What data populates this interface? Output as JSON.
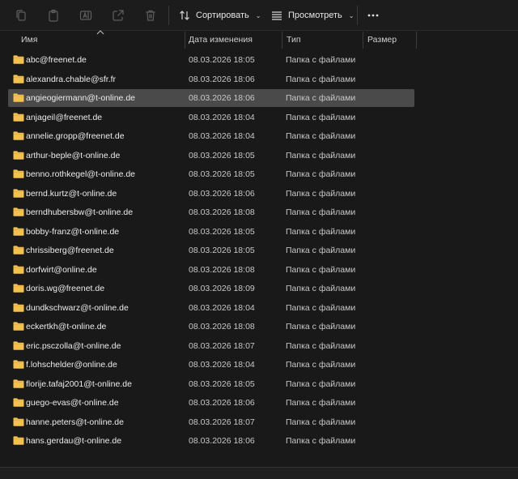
{
  "toolbar": {
    "sort_label": "Сортировать",
    "view_label": "Просмотреть",
    "icons": [
      "copy-icon",
      "paste-icon",
      "rename-icon",
      "share-icon",
      "delete-icon",
      "sort-icon",
      "view-icon",
      "more-icon"
    ]
  },
  "columns": {
    "name": "Имя",
    "date": "Дата изменения",
    "type": "Тип",
    "size": "Размер"
  },
  "colors": {
    "background": "#191919",
    "selected_row": "#4a4a4a",
    "folder": "#f2c14e"
  },
  "files": [
    {
      "name": "abc@freenet.de",
      "date": "08.03.2026 18:05",
      "type": "Папка с файлами"
    },
    {
      "name": "alexandra.chable@sfr.fr",
      "date": "08.03.2026 18:06",
      "type": "Папка с файлами"
    },
    {
      "name": "angieogiermann@t-online.de",
      "date": "08.03.2026 18:06",
      "type": "Папка с файлами",
      "selected": true
    },
    {
      "name": "anjageil@freenet.de",
      "date": "08.03.2026 18:04",
      "type": "Папка с файлами"
    },
    {
      "name": "annelie.gropp@freenet.de",
      "date": "08.03.2026 18:04",
      "type": "Папка с файлами"
    },
    {
      "name": "arthur-beple@t-online.de",
      "date": "08.03.2026 18:05",
      "type": "Папка с файлами"
    },
    {
      "name": "benno.rothkegel@t-online.de",
      "date": "08.03.2026 18:05",
      "type": "Папка с файлами"
    },
    {
      "name": "bernd.kurtz@t-online.de",
      "date": "08.03.2026 18:06",
      "type": "Папка с файлами"
    },
    {
      "name": "berndhubersbw@t-online.de",
      "date": "08.03.2026 18:08",
      "type": "Папка с файлами"
    },
    {
      "name": "bobby-franz@t-online.de",
      "date": "08.03.2026 18:05",
      "type": "Папка с файлами"
    },
    {
      "name": "chrissiberg@freenet.de",
      "date": "08.03.2026 18:05",
      "type": "Папка с файлами"
    },
    {
      "name": "dorfwirt@online.de",
      "date": "08.03.2026 18:08",
      "type": "Папка с файлами"
    },
    {
      "name": "doris.wg@freenet.de",
      "date": "08.03.2026 18:09",
      "type": "Папка с файлами"
    },
    {
      "name": "dundkschwarz@t-online.de",
      "date": "08.03.2026 18:04",
      "type": "Папка с файлами"
    },
    {
      "name": "eckertkh@t-online.de",
      "date": "08.03.2026 18:08",
      "type": "Папка с файлами"
    },
    {
      "name": "eric.psczolla@t-online.de",
      "date": "08.03.2026 18:07",
      "type": "Папка с файлами"
    },
    {
      "name": "f.lohschelder@online.de",
      "date": "08.03.2026 18:04",
      "type": "Папка с файлами"
    },
    {
      "name": "florije.tafaj2001@t-online.de",
      "date": "08.03.2026 18:05",
      "type": "Папка с файлами"
    },
    {
      "name": "guego-evas@t-online.de",
      "date": "08.03.2026 18:06",
      "type": "Папка с файлами"
    },
    {
      "name": "hanne.peters@t-online.de",
      "date": "08.03.2026 18:07",
      "type": "Папка с файлами"
    },
    {
      "name": "hans.gerdau@t-online.de",
      "date": "08.03.2026 18:06",
      "type": "Папка с файлами"
    }
  ]
}
